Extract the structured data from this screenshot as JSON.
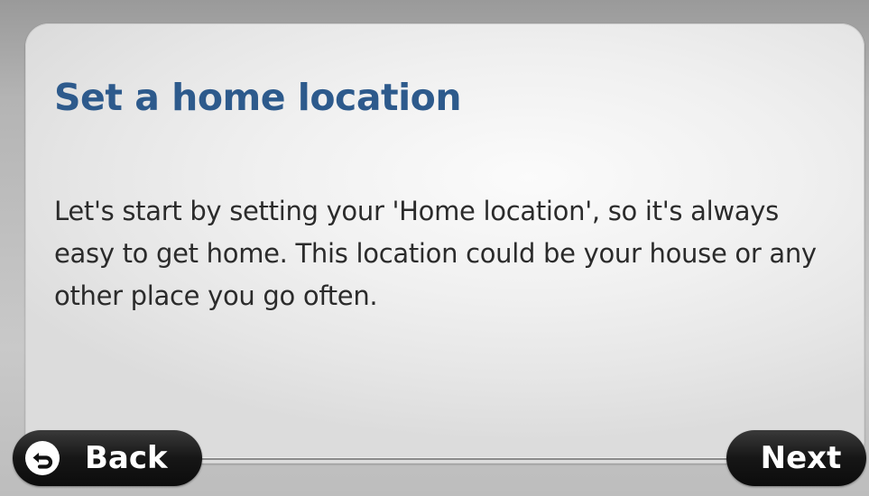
{
  "dialog": {
    "title": "Set a home location",
    "body": "Let's start by setting your 'Home location', so it's always easy to get home. This location could be your house or any other place you go often."
  },
  "buttons": {
    "back_label": "Back",
    "next_label": "Next"
  },
  "icons": {
    "back": "back-arrow-icon"
  },
  "colors": {
    "title": "#2d5a8c",
    "button_bg": "#111111",
    "button_text": "#ffffff"
  }
}
